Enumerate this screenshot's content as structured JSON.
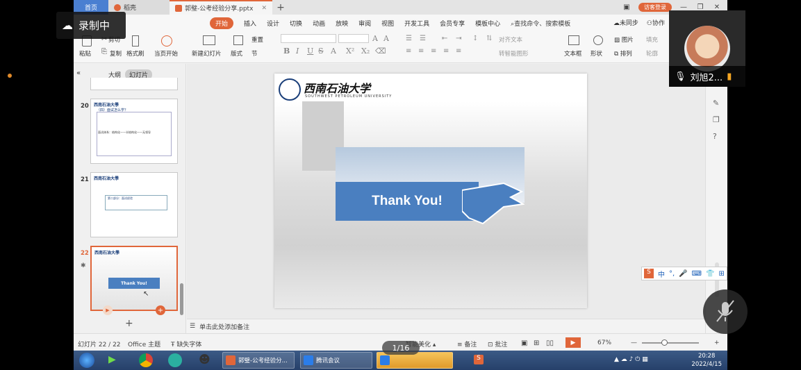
{
  "titlebar": {
    "home_tab": "首页",
    "draft_tab": "稻壳",
    "doc_tab": "郭璧-公考经验分享.pptx",
    "visitor_login": "访客登录"
  },
  "menu": {
    "items": [
      "开始",
      "插入",
      "设计",
      "切换",
      "动画",
      "放映",
      "审阅",
      "视图",
      "开发工具",
      "会员专享",
      "模板中心"
    ],
    "active": "开始",
    "search": "查找命令、搜索模板",
    "sync": "未同步",
    "collab": "协作"
  },
  "ribbon": {
    "paste": "粘贴",
    "cut": "剪切",
    "copy": "复制",
    "format_painter": "格式刷",
    "from_current": "当页开始",
    "new_slide": "新建幻灯片",
    "layout": "版式",
    "reset": "重置",
    "section": "节",
    "text_direction": "对齐文本",
    "smartart": "转智能图形",
    "textbox": "文本框",
    "shape": "形状",
    "arrange": "排列",
    "picture": "图片",
    "fill": "填充",
    "outline": "轮廓"
  },
  "panel": {
    "tab_outline": "大纲",
    "tab_slides": "幻灯片",
    "slide_numbers": [
      "20",
      "21",
      "22"
    ],
    "thumb20_title": "（四）面试怎么学？",
    "thumb20_text": "面试体系：结构化——半结构化——无领导",
    "thumb21_text": "第二部分：面试经验",
    "thumb22_text": "Thank You!"
  },
  "slide": {
    "university_cn": "西南石油大学",
    "university_en": "SOUTHWEST PETROLEUM UNIVERSITY",
    "banner_text": "Thank You!"
  },
  "notes": {
    "placeholder": "单击此处添加备注"
  },
  "status": {
    "slide_counter": "幻灯片 22 / 22",
    "theme": "Office 主题",
    "missing_font": "缺失字体",
    "beautify": "智能美化",
    "notes_btn": "备注",
    "comments_btn": "批注",
    "zoom": "67%"
  },
  "overlay": {
    "recording": "录制中",
    "participant": "刘旭2...",
    "page_indicator": "1/16"
  },
  "taskbar": {
    "task1": "郭璧-公考经验分...",
    "task2": "腾讯会议",
    "time": "20:28",
    "date": "2022/4/15"
  },
  "colors": {
    "accent": "#e0663a",
    "brand_blue": "#1b3f7a",
    "banner_blue": "#4a7fc0"
  }
}
